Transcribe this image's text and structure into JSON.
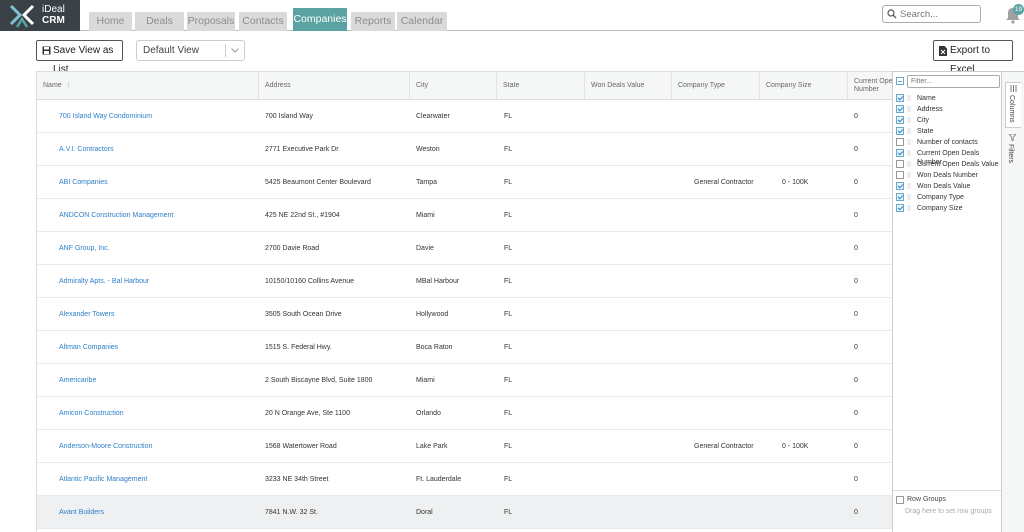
{
  "app": {
    "brand_line1": "iDeal",
    "brand_line2": "CRM",
    "tabs": [
      "Home",
      "Deals",
      "Proposals",
      "Contacts",
      "Companies",
      "Reports",
      "Calendar"
    ],
    "active_tab": "Companies",
    "search_placeholder": "Search...",
    "notification_count": "19",
    "accent_color": "#5aa3a2"
  },
  "toolbar": {
    "save_view_label": "Save View as List",
    "view_select_value": "Default View",
    "export_label": "Export to Excel"
  },
  "grid": {
    "columns": [
      "Name",
      "Address",
      "City",
      "State",
      "Won Deals Value",
      "Company Type",
      "Company Size",
      "Current Ope Number"
    ],
    "sort_indicator": "↑",
    "rows": [
      {
        "name": "700 Island Way Condominium",
        "address": "700 Island Way",
        "city": "Clearwater",
        "state": "FL",
        "type": "",
        "size": "",
        "open": "0"
      },
      {
        "name": "A.V.I. Contractors",
        "address": "2771 Executive Park Dr",
        "city": "Weston",
        "state": "FL",
        "type": "",
        "size": "",
        "open": "0"
      },
      {
        "name": "ABI Companies",
        "address": "5425 Beaumont Center Boulevard",
        "city": "Tampa",
        "state": "FL",
        "type": "General Contractor",
        "size": "0 - 100K",
        "open": "0"
      },
      {
        "name": "ANDCON Construction Management",
        "address": "425 NE 22nd St., #1904",
        "city": "Miami",
        "state": "FL",
        "type": "",
        "size": "",
        "open": "0"
      },
      {
        "name": "ANF Group, Inc.",
        "address": "2700 Davie Road",
        "city": "Davie",
        "state": "FL",
        "type": "",
        "size": "",
        "open": "0"
      },
      {
        "name": "Admiralty Apts. - Bal Harbour",
        "address": "10150/10160 Collins Avenue",
        "city": "MBal Harbour",
        "state": "FL",
        "type": "",
        "size": "",
        "open": "0"
      },
      {
        "name": "Alexander Towers",
        "address": "3505 South Ocean Drive",
        "city": "Hollywood",
        "state": "FL",
        "type": "",
        "size": "",
        "open": "0"
      },
      {
        "name": "Altman Companies",
        "address": "1515 S. Federal Hwy.",
        "city": "Boca Raton",
        "state": "FL",
        "type": "",
        "size": "",
        "open": "0"
      },
      {
        "name": "Americaribe",
        "address": "2 South Biscayne Blvd, Suite 1800",
        "city": "Miami",
        "state": "FL",
        "type": "",
        "size": "",
        "open": "0"
      },
      {
        "name": "Amicon Construction",
        "address": "20 N Orange Ave, Ste 1100",
        "city": "Orlando",
        "state": "FL",
        "type": "",
        "size": "",
        "open": "0"
      },
      {
        "name": "Anderson-Moore Construction",
        "address": "1568 Watertower Road",
        "city": "Lake Park",
        "state": "FL",
        "type": "General Contractor",
        "size": "0 - 100K",
        "open": "0"
      },
      {
        "name": "Atlantic Pacific Management",
        "address": "3233 NE 34th Street",
        "city": "Ft. Lauderdale",
        "state": "FL",
        "type": "",
        "size": "",
        "open": "0"
      },
      {
        "name": "Avant Builders",
        "address": "7841 N.W. 32 St.",
        "city": "Doral",
        "state": "FL",
        "type": "",
        "size": "",
        "open": "0"
      }
    ],
    "selected_row": 12
  },
  "columns_panel": {
    "filter_placeholder": "Filter...",
    "items": [
      {
        "label": "Name",
        "checked": true
      },
      {
        "label": "Address",
        "checked": true
      },
      {
        "label": "City",
        "checked": true
      },
      {
        "label": "State",
        "checked": true
      },
      {
        "label": "Number of contacts",
        "checked": false
      },
      {
        "label": "Current Open Deals Number",
        "checked": true
      },
      {
        "label": "Current Open Deals Value",
        "checked": false
      },
      {
        "label": "Won Deals Number",
        "checked": false
      },
      {
        "label": "Won Deals Value",
        "checked": true
      },
      {
        "label": "Company Type",
        "checked": true
      },
      {
        "label": "Company Size",
        "checked": true
      }
    ],
    "row_groups_label": "Row Groups",
    "row_groups_hint": "Drag here to set row groups"
  },
  "side_tabs": [
    "Columns",
    "Filters"
  ]
}
